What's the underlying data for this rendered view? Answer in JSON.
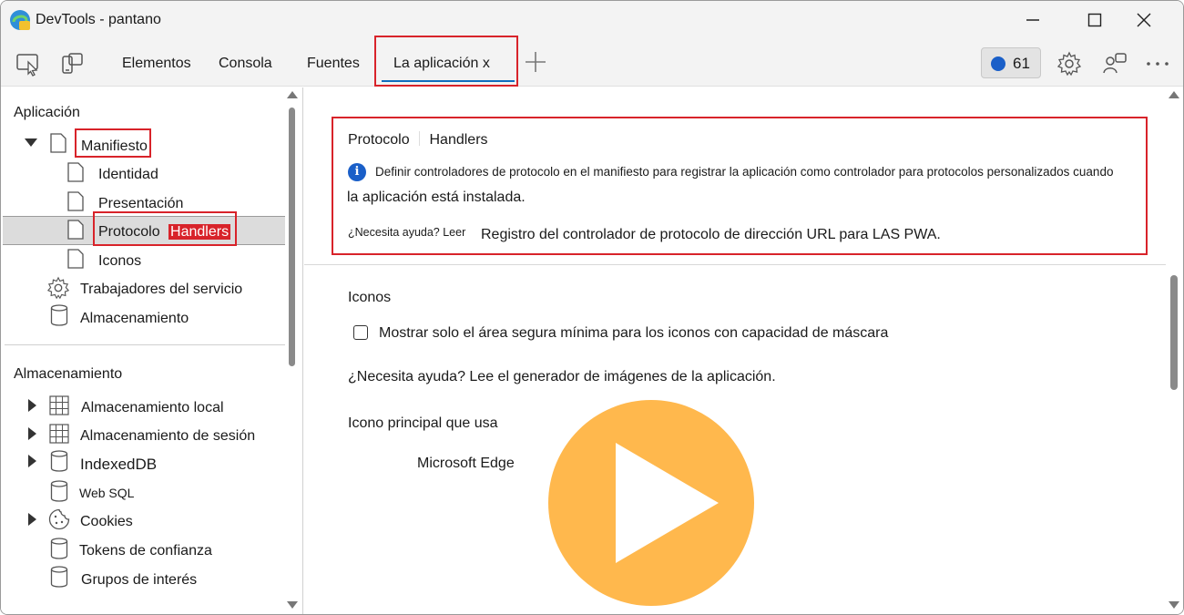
{
  "window": {
    "title": "DevTools - pantano"
  },
  "toolbar": {
    "tabs": [
      {
        "label": "Elementos"
      },
      {
        "label": "Consola"
      },
      {
        "label": "Fuentes"
      },
      {
        "label": "La aplicación x"
      }
    ],
    "active_tab": "La aplicación x",
    "issues_count": "61"
  },
  "sidebar": {
    "section_app": "Aplicación",
    "manifest": "Manifiesto",
    "manifest_children": [
      "Identidad",
      "Presentación",
      "Protocolo",
      "Iconos"
    ],
    "protocol_label": "Protocolo",
    "protocol_handlers": "Handlers",
    "service_workers": "Trabajadores del servicio",
    "storage_item": "Almacenamiento",
    "section_storage": "Almacenamiento",
    "storage_items": [
      "Almacenamiento local",
      "Almacenamiento de sesión",
      "IndexedDB",
      "Web SQL",
      "Cookies",
      "Tokens de confianza",
      "Grupos de interés"
    ]
  },
  "main": {
    "protocol_title_a": "Protocolo",
    "protocol_title_b": "Handlers",
    "info_line1": "Definir controladores de protocolo en el manifiesto para registrar la aplicación como controlador para protocolos personalizados cuando",
    "info_line2": "la aplicación está instalada.",
    "help_prefix": "¿Necesita ayuda? Leer",
    "help_link": "Registro del controlador de protocolo de dirección URL para LAS PWA.",
    "icons_title": "Iconos",
    "checkbox_label": "Mostrar solo el área segura mínima para los iconos con capacidad de máscara",
    "icons_help": "¿Necesita ayuda? Lee el generador de imágenes de la aplicación.",
    "primary_icon_label": "Icono principal que usa",
    "primary_icon_value": "Microsoft Edge"
  },
  "colors": {
    "highlight_red": "#d8232a",
    "accent_blue": "#0f6cbd",
    "info_blue": "#1a5fc8",
    "play_orange": "#ffb84d"
  }
}
